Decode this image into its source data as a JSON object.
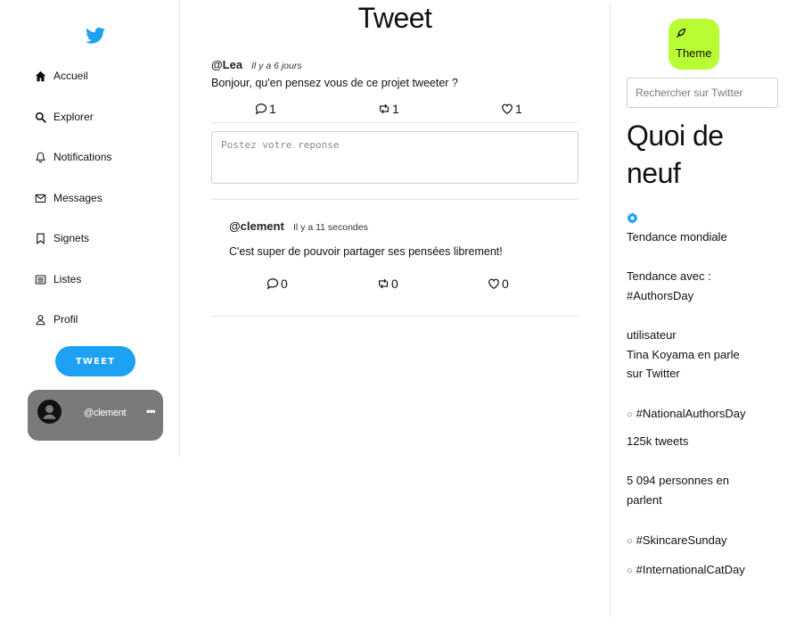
{
  "sidebar": {
    "nav": [
      {
        "label": "Accueil",
        "icon": "home-icon"
      },
      {
        "label": "Explorer",
        "icon": "search-icon"
      },
      {
        "label": "Notifications",
        "icon": "bell-icon"
      },
      {
        "label": "Messages",
        "icon": "envelope-icon"
      },
      {
        "label": "Signets",
        "icon": "bookmark-icon"
      },
      {
        "label": "Listes",
        "icon": "list-icon"
      },
      {
        "label": "Profil",
        "icon": "user-icon"
      }
    ],
    "tweet_button": "TWEET",
    "user": {
      "handle": "@clement",
      "more": "•••"
    }
  },
  "main": {
    "title": "Tweet",
    "tweet": {
      "author": "@Lea",
      "time": "Il y a 6 jours",
      "text": "Bonjour, qu'en pensez vous de ce projet tweeter ?",
      "comments": "1",
      "retweets": "1",
      "likes": "1"
    },
    "reply_placeholder": "Postez votre reponse",
    "reply": {
      "author": "@clement",
      "time": "Il y a 11 secondes",
      "text": "C'est super de pouvoir partager ses pensées librement!",
      "comments": "0",
      "retweets": "0",
      "likes": "0"
    }
  },
  "right": {
    "theme_label": "Theme",
    "search_placeholder": "Rechercher sur Twitter",
    "title": "Quoi de neuf",
    "world_trend": "Tendance mondiale",
    "trend_with_label": "Tendance avec :",
    "trend_with_tag": "#AuthorsDay",
    "user_label": "utilisateur",
    "user_line1": "Tina Koyama en parle",
    "user_line2": "sur Twitter",
    "trend1": "#NationalAuthorsDay",
    "trend1_count": "125k tweets",
    "trend1_people_1": "5 094 personnes en",
    "trend1_people_2": "parlent",
    "trend2": "#SkincareSunday",
    "trend3": "#InternationalCatDay"
  },
  "colors": {
    "brand": "#1da1f2",
    "theme_button": "#b8fc33",
    "user_card": "#7a7a7a"
  }
}
